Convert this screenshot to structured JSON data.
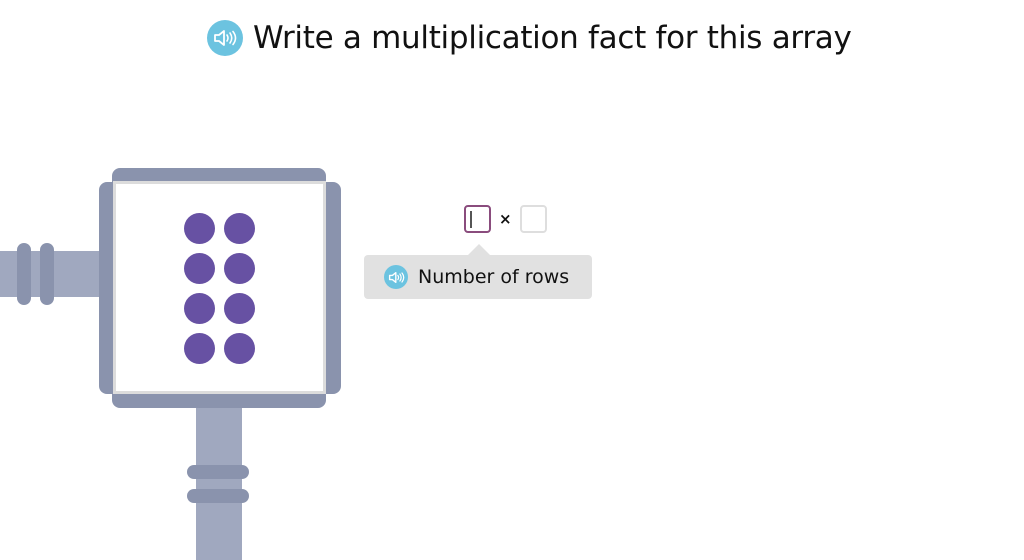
{
  "prompt": {
    "title": "Write a multiplication fact for this array",
    "audio_icon": "speaker-icon"
  },
  "array": {
    "rows": 4,
    "columns": 2,
    "dot_color": "#6751a3",
    "frame_color": "#8a93ad",
    "pipe_color": "#a0a8bf"
  },
  "equation": {
    "factor1_value": "",
    "operator": "×",
    "factor2_value": "",
    "active_field": "factor1",
    "active_border_color": "#8a4c7d"
  },
  "hint": {
    "text": "Number of rows",
    "audio_icon": "speaker-icon"
  }
}
